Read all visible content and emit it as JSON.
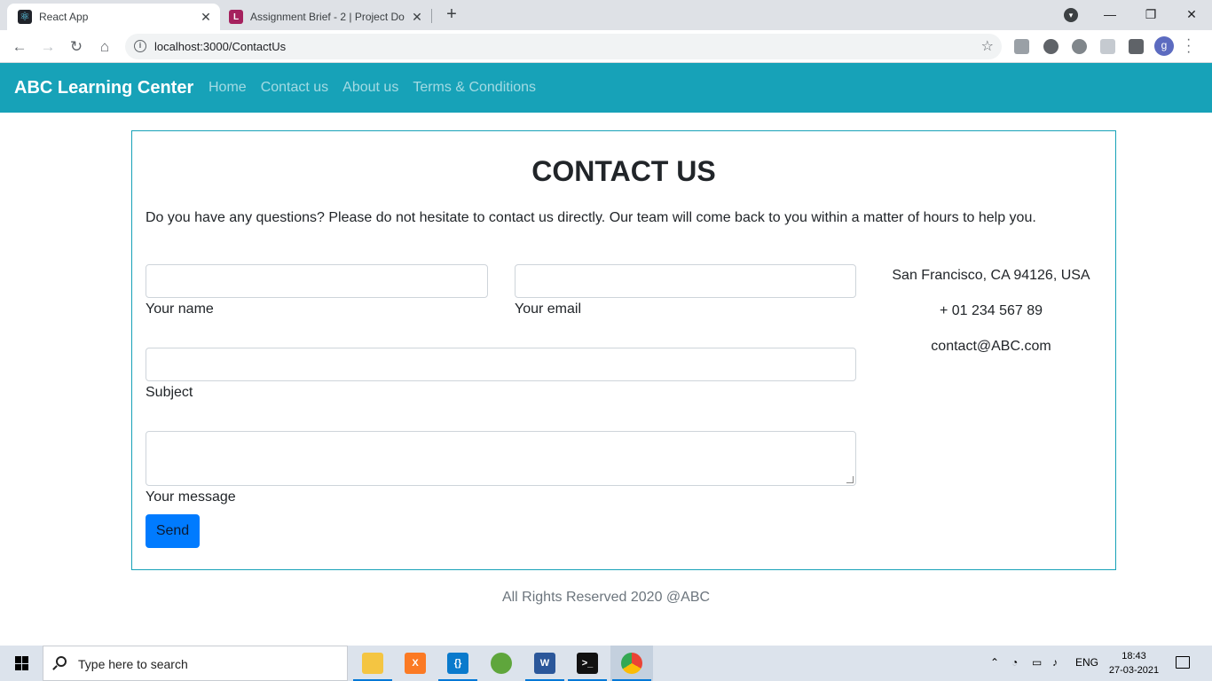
{
  "browser": {
    "tabs": [
      {
        "title": "React App",
        "favicon": "react-logo"
      },
      {
        "title": "Assignment Brief - 2 | Project Do",
        "favicon": "L"
      }
    ],
    "url": "localhost:3000/ContactUs",
    "profile_initial": "g"
  },
  "navbar": {
    "brand": "ABC Learning Center",
    "links": [
      "Home",
      "Contact us",
      "About us",
      "Terms & Conditions"
    ],
    "color": "#17a2b8"
  },
  "contact": {
    "heading": "CONTACT US",
    "intro": "Do you have any questions? Please do not hesitate to contact us directly. Our team will come back to you within a matter of hours to help you.",
    "fields": {
      "name_label": "Your name",
      "email_label": "Your email",
      "subject_label": "Subject",
      "message_label": "Your message"
    },
    "send_label": "Send",
    "address": "San Francisco, CA 94126, USA",
    "phone": "+ 01 234 567 89",
    "email": "contact@ABC.com"
  },
  "footer": {
    "text": "All Rights Reserved 2020 @ABC"
  },
  "taskbar": {
    "search_placeholder": "Type here to search",
    "language": "ENG",
    "time": "18:43",
    "date": "27-03-2021",
    "apps": [
      "file-explorer-icon",
      "xampp-icon",
      "vscode-icon",
      "spring-tools-icon",
      "word-icon",
      "terminal-icon",
      "chrome-icon"
    ]
  }
}
